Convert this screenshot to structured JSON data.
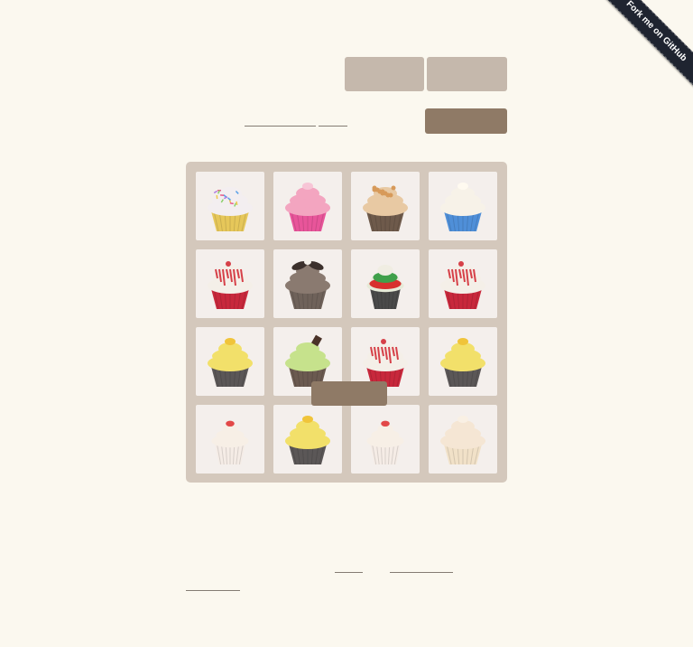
{
  "header": {
    "score_label": "",
    "best_label": "",
    "new_game_label": "",
    "intro_link_1": "",
    "intro_link_2": ""
  },
  "github_ribbon": {
    "text": "Fork me on GitHub"
  },
  "board": {
    "rows": 4,
    "cols": 4,
    "tiles": [
      {
        "row": 0,
        "col": 0,
        "cupcake": "sprinkle-frosting-yellow-liner"
      },
      {
        "row": 0,
        "col": 1,
        "cupcake": "pink-frosting-pink-liner"
      },
      {
        "row": 0,
        "col": 2,
        "cupcake": "crumble-top-brown-liner"
      },
      {
        "row": 0,
        "col": 3,
        "cupcake": "white-frosting-blue-liner"
      },
      {
        "row": 1,
        "col": 0,
        "cupcake": "red-velvet"
      },
      {
        "row": 1,
        "col": 1,
        "cupcake": "cookies-and-cream"
      },
      {
        "row": 1,
        "col": 2,
        "cupcake": "rainbow-layers"
      },
      {
        "row": 1,
        "col": 3,
        "cupcake": "red-velvet"
      },
      {
        "row": 2,
        "col": 0,
        "cupcake": "lemon-frosting-gray-liner"
      },
      {
        "row": 2,
        "col": 1,
        "cupcake": "green-frosting-chocolate"
      },
      {
        "row": 2,
        "col": 2,
        "cupcake": "red-velvet"
      },
      {
        "row": 2,
        "col": 3,
        "cupcake": "lemon-frosting-gray-liner"
      },
      {
        "row": 3,
        "col": 0,
        "cupcake": "mini-strawberry"
      },
      {
        "row": 3,
        "col": 1,
        "cupcake": "lemon-frosting-gray-liner"
      },
      {
        "row": 3,
        "col": 2,
        "cupcake": "mini-strawberry"
      },
      {
        "row": 3,
        "col": 3,
        "cupcake": "vanilla-swirl-white-liner"
      }
    ]
  },
  "board_overlay": {
    "button_label": ""
  },
  "footer": {
    "link_1": "",
    "link_2": "",
    "link_3": ""
  },
  "colors": {
    "background": "#fbf8ef",
    "board": "#d4c8bc",
    "tile": "#f4efec",
    "button": "#8f7a66",
    "score_box": "#bbada0"
  }
}
